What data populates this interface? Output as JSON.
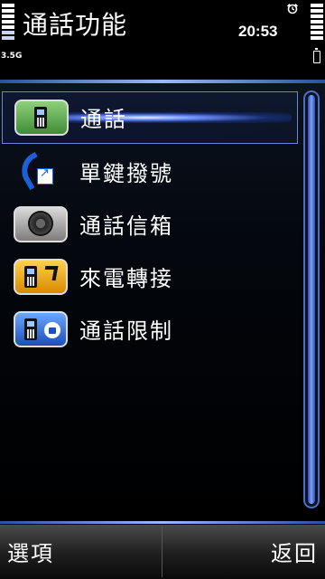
{
  "status": {
    "title": "通話功能",
    "time": "20:53",
    "network": "3.5G",
    "alarm_icon": "alarm-clock-icon"
  },
  "menu": {
    "items": [
      {
        "label": "通話",
        "icon": "phone-settings-icon",
        "selected": true
      },
      {
        "label": "單鍵撥號",
        "icon": "speed-dial-icon",
        "selected": false
      },
      {
        "label": "通話信箱",
        "icon": "voicemail-icon",
        "selected": false
      },
      {
        "label": "來電轉接",
        "icon": "call-divert-icon",
        "selected": false
      },
      {
        "label": "通話限制",
        "icon": "call-barring-icon",
        "selected": false
      }
    ]
  },
  "softkeys": {
    "left": "選項",
    "right": "返回"
  },
  "colors": {
    "accent": "#4c6fbf",
    "background": "#000000"
  }
}
